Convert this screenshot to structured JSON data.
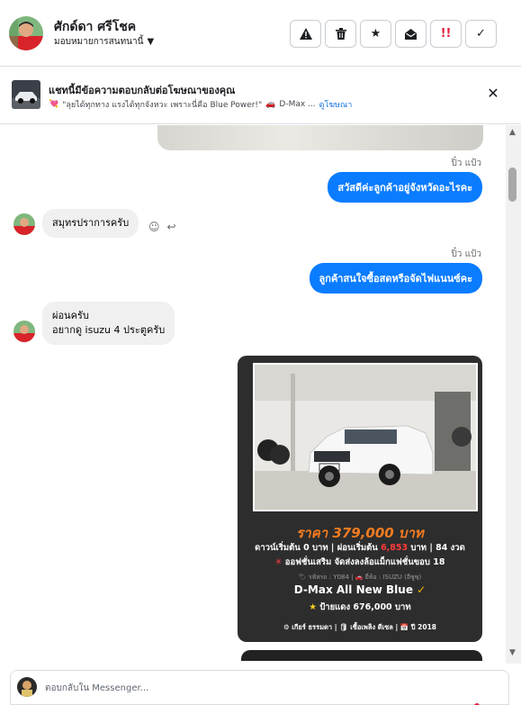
{
  "header": {
    "contact_name": "ศักด์ดา ศรีโชค",
    "assign_label": "มอบหมายการสนทนานี้",
    "actions": [
      {
        "name": "spam-button",
        "icon": "warning-icon",
        "glyph": "⚠"
      },
      {
        "name": "delete-button",
        "icon": "trash-icon",
        "glyph": "🗑"
      },
      {
        "name": "star-button",
        "icon": "star-icon",
        "glyph": "★"
      },
      {
        "name": "mark-unread-button",
        "icon": "envelope-open-icon",
        "glyph": "◒"
      },
      {
        "name": "follow-up-button",
        "icon": "follow-up-icon",
        "glyph": "!!"
      },
      {
        "name": "done-button",
        "icon": "check-icon",
        "glyph": "✓"
      }
    ]
  },
  "ad_banner": {
    "title": "แชทนี้มีข้อความตอบกลับต่อโฆษณาของคุณ",
    "emoji_left": "💘",
    "snippet": "\"ลุยได้ทุกทาง แรงได้ทุกจังหวะ เพราะนี่คือ Blue Power!\"",
    "emoji_mid": "🚗",
    "snippet_tail": "D-Max ...",
    "link": "ดูโฆษณา",
    "close_glyph": "✕"
  },
  "messages": {
    "outgoing_1": {
      "sender": "ปิ๋ว แป้ว",
      "text": "สวัสดีค่ะลูกค้าอยู่จังหวัดอะไรคะ"
    },
    "incoming_1": {
      "text": "สมุทรปราการครับ"
    },
    "outgoing_2": {
      "sender": "ปิ๋ว แป้ว",
      "text": "ลูกค้าสนใจซื้อสดหรือจัดไฟแนนซ์คะ"
    },
    "incoming_2": {
      "line1": "ผ่อนครับ",
      "line2": "อยากดู isuzu 4 ประตูครับ"
    },
    "tool_icons": {
      "react": "☺",
      "reply": "↩"
    }
  },
  "ad_card": {
    "price": "ราคา 379,000 บาท",
    "l1_pre": "ดาวน์เริ่มต้น 0 บาท | ผ่อนเริ่มต้น ",
    "l1_hl": "6,853",
    "l1_post": " บาท | 84 งวด",
    "l2_star": "✳",
    "l2_text": " ออฟชั่นเสริม จัดส่งลงล้อแม็กแฟชั่นขอบ 18",
    "l3": "🏷 รหัสรถ : Y084 | 🚗 ยี่ห้อ : ISUZU (อีซูซุ)",
    "model": "D-Max All New Blue",
    "model_badge": "✓",
    "l4_star": "★",
    "l4_text": " ป้ายแดง 676,000 บาท",
    "l5": "⚙ เกียร์ ธรรมดา   |   🛢 เชื้อเพลิง ดีเซล   |   📅 ปี 2018",
    "plate": "ป้ายแดง"
  },
  "scrollbar": {
    "up": "▲",
    "down": "▼"
  },
  "composer": {
    "placeholder": "ตอบกลับใน Messenger..."
  },
  "colors": {
    "accent_blue": "#0a7cff",
    "bubble_gray": "#f0f0f0",
    "card_dark": "#2d2d2d",
    "price_orange": "#f47b20",
    "highlight_red": "#ff3b3b"
  }
}
